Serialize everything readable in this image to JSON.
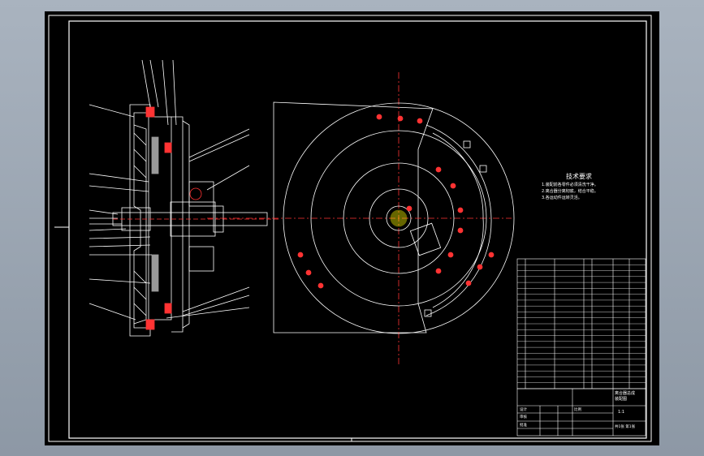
{
  "viewport": {
    "background": "#000000",
    "line_color": "#ffffff",
    "center_line_color": "#ff2020"
  },
  "technical_requirements": {
    "title": "技术要求",
    "lines": [
      "1.装配前各零件必须清洗干净。",
      "2.离合器分离彻底，结合平稳。",
      "3.各运动件运转灵活。"
    ]
  },
  "title_block": {
    "drawing_name": "离合器总成\n装配图",
    "sheet_label": "共1张 第1张",
    "drawn_by_label": "设计",
    "checked_by_label": "审核",
    "approved_label": "批准",
    "scale_label": "比例",
    "scale": "1:1"
  },
  "bom_rows": 22
}
